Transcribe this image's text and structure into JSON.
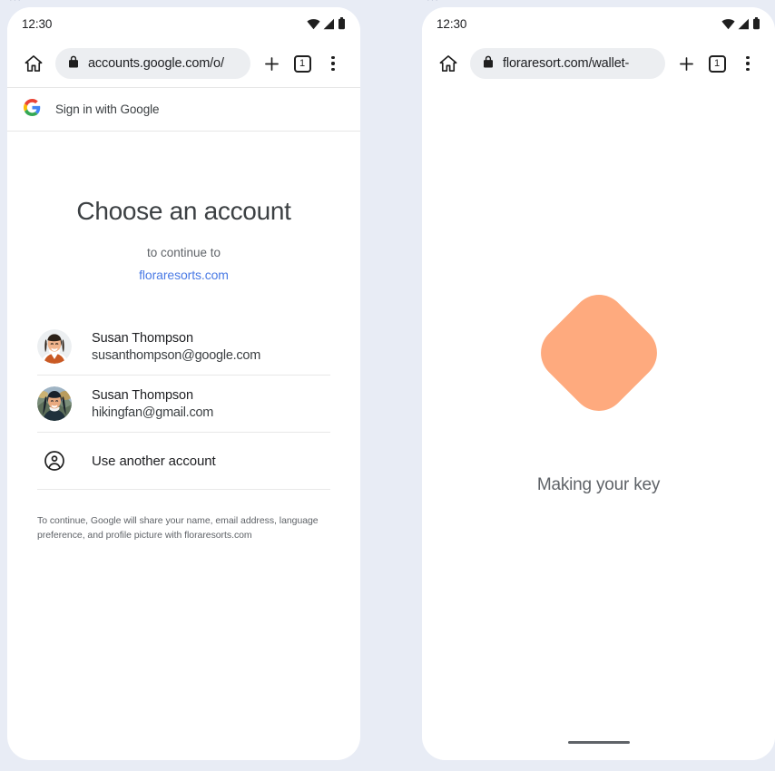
{
  "canvas": {
    "background_color": "#E8ECF5",
    "ghost_text_left": "···",
    "ghost_text_right": "···"
  },
  "phones": [
    {
      "id": "left",
      "status_bar": {
        "clock": "12:30",
        "icons": [
          "wifi-icon",
          "signal-icon",
          "battery-icon"
        ]
      },
      "browser": {
        "home_icon": "home-icon",
        "lock_icon": "lock-icon",
        "url": "accounts.google.com/o/",
        "new_tab_icon": "plus-icon",
        "tab_count": "1",
        "menu_icon": "more-vertical-icon"
      },
      "google_header": {
        "logo_icon": "google-g-icon",
        "label": "Sign in with Google"
      },
      "content": {
        "headline": "Choose an account",
        "subline": "to continue to",
        "site_link": "floraresorts.com",
        "site_link_color": "#4B7BE5",
        "accounts": [
          {
            "name": "Susan Thompson",
            "email": "susanthompson@google.com",
            "avatar": "avatar-portrait-orange-collar"
          },
          {
            "name": "Susan Thompson",
            "email": "hikingfan@gmail.com",
            "avatar": "avatar-portrait-outdoors"
          }
        ],
        "use_another_account": {
          "icon": "account-circle-icon",
          "label": "Use another account"
        },
        "disclaimer": "To continue, Google will share your name, email address, language preference, and profile picture with floraresorts.com"
      }
    },
    {
      "id": "right",
      "status_bar": {
        "clock": "12:30",
        "icons": [
          "wifi-icon",
          "signal-icon",
          "battery-icon"
        ]
      },
      "browser": {
        "home_icon": "home-icon",
        "lock_icon": "lock-icon",
        "url": "floraresort.com/wallet-",
        "new_tab_icon": "plus-icon",
        "tab_count": "1",
        "menu_icon": "more-vertical-icon"
      },
      "content": {
        "shape": "rotated-rounded-square",
        "shape_color": "#FEAA7E",
        "caption": "Making your key"
      }
    }
  ]
}
